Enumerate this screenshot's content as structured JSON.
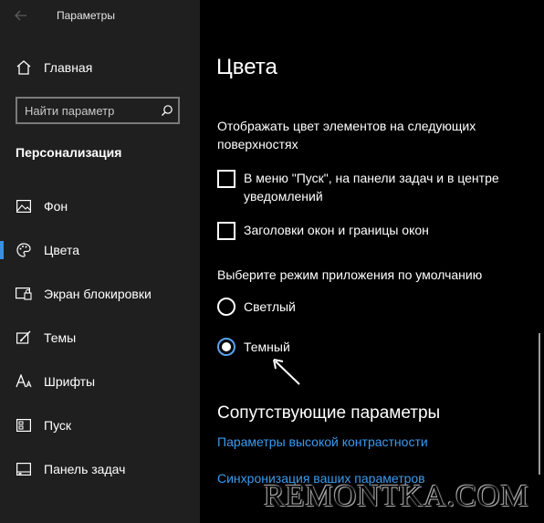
{
  "window": {
    "title": "Параметры",
    "controls": {
      "minimize": "—",
      "maximize": "☐",
      "close": "✕"
    }
  },
  "sidebar": {
    "home_label": "Главная",
    "search": {
      "placeholder": "Найти параметр"
    },
    "section_title": "Персонализация",
    "items": [
      {
        "label": "Фон",
        "icon": "image-icon",
        "active": false
      },
      {
        "label": "Цвета",
        "icon": "palette-icon",
        "active": true
      },
      {
        "label": "Экран блокировки",
        "icon": "lock-screen-icon",
        "active": false
      },
      {
        "label": "Темы",
        "icon": "brush-icon",
        "active": false
      },
      {
        "label": "Шрифты",
        "icon": "font-icon",
        "active": false
      },
      {
        "label": "Пуск",
        "icon": "start-icon",
        "active": false
      },
      {
        "label": "Панель задач",
        "icon": "taskbar-icon",
        "active": false
      }
    ]
  },
  "main": {
    "title": "Цвета",
    "surfaces_desc": "Отображать цвет элементов на следующих поверхностях",
    "checkboxes": [
      {
        "label": "В меню \"Пуск\", на панели задач и в центре уведомлений",
        "checked": false
      },
      {
        "label": "Заголовки окон и границы окон",
        "checked": false
      }
    ],
    "mode_title": "Выберите режим приложения по умолчанию",
    "radios": [
      {
        "label": "Светлый",
        "checked": false
      },
      {
        "label": "Темный",
        "checked": true
      }
    ],
    "related_title": "Сопутствующие параметры",
    "links": [
      "Параметры высокой контрастности",
      "Синхронизация ваших параметров"
    ]
  },
  "watermark": "REMONTKA.COM",
  "colors": {
    "accent": "#3a8ee6",
    "link": "#3a9bf0",
    "sidebar_bg": "#1f1f1f",
    "main_bg": "#000000"
  }
}
